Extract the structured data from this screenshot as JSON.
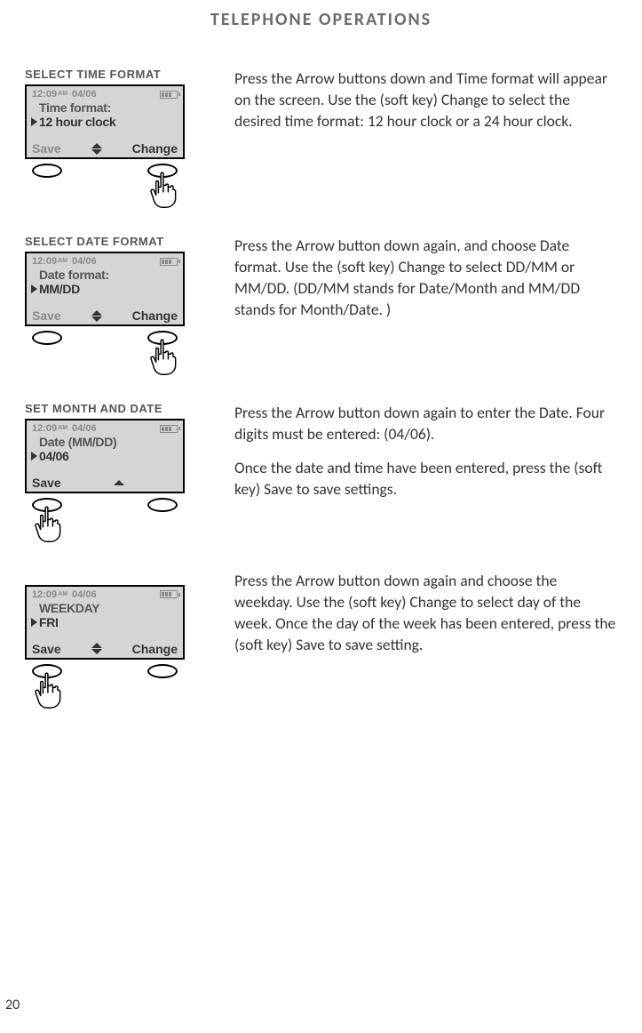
{
  "page": {
    "title": "TELEPHONE OPERATIONS",
    "number": "20"
  },
  "common": {
    "time": "12:09",
    "ampm": "AM",
    "date": "04/06",
    "save": "Save",
    "change": "Change"
  },
  "sections": [
    {
      "label": "SELECT TIME FORMAT",
      "line1": "Time format:",
      "line2": "12 hour clock",
      "showChange": true,
      "showUpDown": "both",
      "saveDark": false,
      "handSide": "right",
      "body": [
        "Press the Arrow buttons down and Time format will appear on the screen. Use the (soft key) Change to select the desired time format: 12 hour clock or a 24 hour clock."
      ]
    },
    {
      "label": "SELECT DATE FORMAT",
      "line1": "Date format:",
      "line2": "MM/DD",
      "showChange": true,
      "showUpDown": "both",
      "saveDark": false,
      "handSide": "right",
      "body": [
        "Press the Arrow button down again, and choose Date format. Use the (soft key) Change to select DD/MM or MM/DD. (DD/MM stands for Date/Month and MM/DD stands for Month/Date. )"
      ]
    },
    {
      "label": "SET MONTH AND DATE",
      "line1": "Date  (MM/DD)",
      "line2": "04/06",
      "showChange": false,
      "showUpDown": "up",
      "saveDark": true,
      "handSide": "left",
      "body": [
        "Press the Arrow button down again to enter the Date. Four digits must be entered: (04/06).",
        "Once the date and time have been entered, press the (soft key) Save to save settings."
      ]
    },
    {
      "label": "",
      "line1": "WEEKDAY",
      "line2": "FRI",
      "showChange": true,
      "showUpDown": "both",
      "saveDark": true,
      "handSide": "left",
      "body": [
        "Press the Arrow button down again and choose the weekday. Use the (soft key) Change to select day of the week. Once the day of the week has been entered, press the (soft key) Save to save setting."
      ]
    }
  ]
}
